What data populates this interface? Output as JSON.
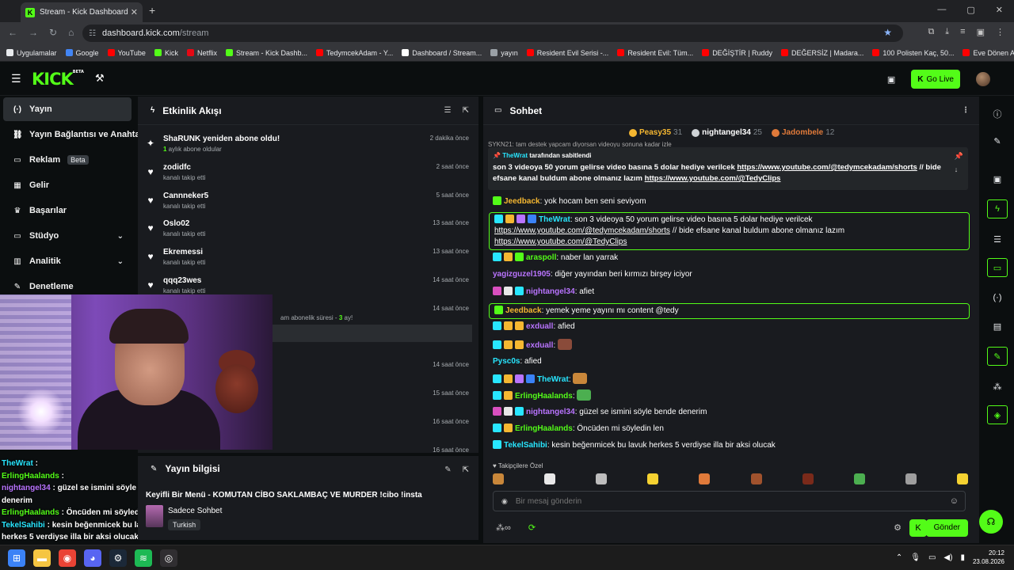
{
  "browser": {
    "tab_title": "Stream - Kick Dashboard",
    "tab_favicon": "K",
    "new_tab": "+",
    "url_host": "dashboard.kick.com",
    "url_path": "/stream",
    "bookmarks": [
      {
        "label": "Uygulamalar",
        "color": "#e8eaed"
      },
      {
        "label": "Google",
        "color": "#4285f4"
      },
      {
        "label": "YouTube",
        "color": "#ff0000"
      },
      {
        "label": "Kick",
        "color": "#53fc18"
      },
      {
        "label": "Netflix",
        "color": "#e50914"
      },
      {
        "label": "Stream - Kick Dashb...",
        "color": "#53fc18"
      },
      {
        "label": "TedymcekAdam - Y...",
        "color": "#ff0000"
      },
      {
        "label": "Dashboard / Stream...",
        "color": "#ffffff"
      },
      {
        "label": "yayın",
        "color": "#9aa0a6"
      },
      {
        "label": "Resident Evil Serisi -...",
        "color": "#ff0000"
      },
      {
        "label": "Resident Evil: Tüm...",
        "color": "#ff0000"
      },
      {
        "label": "DEĞİŞTİR | Ruddy",
        "color": "#ff0000"
      },
      {
        "label": "DEĞERSİZ | Madara...",
        "color": "#ff0000"
      },
      {
        "label": "100 Polisten Kaç, 50...",
        "color": "#ff0000"
      },
      {
        "label": "Eve Dönen Aile Bekl...",
        "color": "#ff0000"
      }
    ]
  },
  "kick": {
    "logo": "KICK",
    "logo_tag": "BETA",
    "go_live": "Go Live",
    "brand_color": "#53fc18"
  },
  "sidebar": {
    "items": [
      {
        "label": "Yayın",
        "icon": "broadcast-icon",
        "glyph": "(·)",
        "active": true
      },
      {
        "label": "Yayın Bağlantısı ve Anahtarı",
        "icon": "link-icon",
        "glyph": "⛓"
      },
      {
        "label": "Reklam",
        "icon": "ad-icon",
        "glyph": "▭",
        "badge": "Beta"
      },
      {
        "label": "Gelir",
        "icon": "revenue-icon",
        "glyph": "▦"
      },
      {
        "label": "Başarılar",
        "icon": "trophy-icon",
        "glyph": "♛"
      },
      {
        "label": "Stüdyo",
        "icon": "studio-icon",
        "glyph": "▭",
        "chevron": true
      },
      {
        "label": "Analitik",
        "icon": "analytics-icon",
        "glyph": "▥",
        "chevron": true
      },
      {
        "label": "Denetleme",
        "icon": "moderation-icon",
        "glyph": "✎"
      }
    ]
  },
  "events": {
    "title": "Etkinlik Akışı",
    "items": [
      {
        "icon": "sparkle-icon",
        "glyph": "✦",
        "name": "ShaRUNK yeniden abone oldu!",
        "sub_prefix": "1",
        "sub": " aylık abone oldular",
        "time": "2 dakika önce"
      },
      {
        "icon": "heart-icon",
        "glyph": "♥",
        "name": "zodidfc",
        "sub": "kanalı takip etti",
        "time": "2 saat önce"
      },
      {
        "icon": "heart-icon",
        "glyph": "♥",
        "name": "Cannneker5",
        "sub": "kanalı takip etti",
        "time": "5 saat önce"
      },
      {
        "icon": "heart-icon",
        "glyph": "♥",
        "name": "Oslo02",
        "sub": "kanalı takip etti",
        "time": "13 saat önce"
      },
      {
        "icon": "heart-icon",
        "glyph": "♥",
        "name": "Ekremessi",
        "sub": "kanalı takip etti",
        "time": "13 saat önce"
      },
      {
        "icon": "heart-icon",
        "glyph": "♥",
        "name": "qqq23wes",
        "sub": "kanalı takip etti",
        "time": "14 saat önce"
      },
      {
        "icon": "",
        "glyph": "",
        "name": "",
        "sub": "am abonelik süresi - ",
        "sub_suffix": "3",
        "sub_end": " ay!",
        "time": "14 saat önce"
      },
      {
        "icon": "",
        "glyph": "",
        "name": "",
        "sub": "",
        "time": ""
      },
      {
        "icon": "",
        "glyph": "",
        "name": "",
        "sub": "",
        "time": "14 saat önce"
      },
      {
        "icon": "",
        "glyph": "",
        "name": "",
        "sub": "",
        "time": "15 saat önce"
      },
      {
        "icon": "",
        "glyph": "",
        "name": "",
        "sub": "",
        "time": "16 saat önce"
      },
      {
        "icon": "",
        "glyph": "",
        "name": "",
        "sub": "",
        "time": "16 saat önce"
      }
    ]
  },
  "overlay_chat": [
    {
      "user": "TheWrat",
      "text": " : ",
      "color": "c"
    },
    {
      "user": "ErlingHaalands",
      "text": " : ",
      "color": "g"
    },
    {
      "user": "nightangel34",
      "text": " : güzel se ismini söyle bende denerim",
      "color": "p"
    },
    {
      "user": "ErlingHaalands",
      "text": " : Öncüden mi söyledin len",
      "color": "g"
    },
    {
      "user": "TekelSahibi",
      "text": " : kesin beğenmicek bu lavuk herkes 5 verdiyse illa bir aksi olucak",
      "color": "c"
    }
  ],
  "stream_info": {
    "title": "Yayın bilgisi",
    "stream_title": "Keyifli Bir Menü - KOMUTAN CİBO SAKLAMBAÇ VE MURDER !cibo !insta",
    "category": "Sadece Sohbet",
    "language": "Turkish"
  },
  "chat": {
    "title": "Sohbet",
    "leaderboard": [
      {
        "name": "Peasy35",
        "count": "31",
        "color": "#f5b731"
      },
      {
        "name": "nightangel34",
        "count": "25",
        "color": "#cfd3d6"
      },
      {
        "name": "Jadombele",
        "count": "12",
        "color": "#e07a3a"
      }
    ],
    "pinned_by_user": "TheWrat",
    "pinned_by_text": " tarafından sabitlendi",
    "pinned_text": "son 3 videoya 50 yorum gelirse video basına 5 dolar hediye verilcek ",
    "pinned_link1": "https://www.youtube.com/@tedymcekadam/shorts",
    "pinned_mid": " // bide efsane kanal buldum abone olmanız lazım ",
    "pinned_link2": "https://www.youtube.com/@TedyClips",
    "pinned_under": "SYKN21: tam destek yapcam diyorsan videoyu sonuna kadar izle",
    "messages": [
      {
        "user": "Jeedback",
        "ucolor": "#f5b731",
        "text": ": yok hocam ben seni seviyom",
        "badges": [
          "#53fc18"
        ],
        "hl": false
      },
      {
        "user": "TheWrat",
        "ucolor": "#28e6ff",
        "text": ": son 3 videoya 50 yorum gelirse video basına 5 dolar hediye verilcek ",
        "link1": "https://www.youtube.com/@tedymcekadam/shorts",
        "mid": " // bide efsane kanal buldum abone olmanız lazım ",
        "link2": "https://www.youtube.com/@TedyClips",
        "badges": [
          "#28e6ff",
          "#f5b731",
          "#b974ff",
          "#3b82f6"
        ],
        "hl": true
      },
      {
        "user": "araspoll",
        "ucolor": "#53fc18",
        "text": ": naber lan yarrak",
        "badges": [
          "#28e6ff",
          "#f5b731",
          "#53fc18"
        ],
        "hl": false
      },
      {
        "user": "yagizguzel1905",
        "ucolor": "#b974ff",
        "text": ": diğer yayından beri kırmızı birşey iciyor",
        "badges": [],
        "hl": false
      },
      {
        "user": "nightangel34",
        "ucolor": "#b974ff",
        "text": ": afiet",
        "badges": [
          "#d94fbf",
          "#e8e8e8",
          "#28e6ff"
        ],
        "hl": false
      },
      {
        "user": "Jeedback",
        "ucolor": "#f5b731",
        "text": ": yemek yeme yayını mı content @tedy",
        "badges": [
          "#53fc18"
        ],
        "hl": true
      },
      {
        "user": "exduall",
        "ucolor": "#b974ff",
        "text": ": afied",
        "badges": [
          "#28e6ff",
          "#f5b731",
          "#f5b731"
        ],
        "hl": false
      },
      {
        "user": "exduall",
        "ucolor": "#b974ff",
        "text": ": ",
        "badges": [
          "#28e6ff",
          "#f5b731",
          "#f5b731"
        ],
        "emote": "#8a4b3a",
        "hl": false
      },
      {
        "user": "Pysc0s",
        "ucolor": "#28e6ff",
        "text": ": afied",
        "badges": [],
        "hl": false
      },
      {
        "user": "TheWrat",
        "ucolor": "#28e6ff",
        "text": ": ",
        "badges": [
          "#28e6ff",
          "#f5b731",
          "#b974ff",
          "#3b82f6"
        ],
        "emote": "#c9873a",
        "hl": false
      },
      {
        "user": "ErlingHaalands",
        "ucolor": "#53fc18",
        "text": ": ",
        "badges": [
          "#28e6ff",
          "#f5b731"
        ],
        "emote": "#4caf50",
        "hl": false
      },
      {
        "user": "nightangel34",
        "ucolor": "#b974ff",
        "text": ": güzel se ismini söyle bende denerim",
        "badges": [
          "#d94fbf",
          "#e8e8e8",
          "#28e6ff"
        ],
        "hl": false
      },
      {
        "user": "ErlingHaalands",
        "ucolor": "#53fc18",
        "text": ": Öncüden mi söyledin len",
        "badges": [
          "#28e6ff",
          "#f5b731"
        ],
        "hl": false
      },
      {
        "user": "TekelSahibi",
        "ucolor": "#28e6ff",
        "text": ": kesin beğenmicek bu lavuk herkes 5 verdiyse illa bir aksi olucak",
        "badges": [
          "#28e6ff"
        ],
        "hl": false
      }
    ],
    "emotes_label": "Takipçilere Özel",
    "emote_colors": [
      "#c9873a",
      "#e8e8e8",
      "#bdbdbd",
      "#f5d231",
      "#e07a3a",
      "#a0522d",
      "#7a2a1a",
      "#4caf50",
      "#9e9e9e",
      "#f5d231"
    ],
    "input_placeholder": "Bir mesaj gönderin",
    "send_label": "Gönder"
  },
  "taskbar": {
    "time": "20:12",
    "date": "23.08.2026",
    "apps": [
      {
        "name": "windows-start-icon",
        "color": "#3b82f6",
        "glyph": "⊞"
      },
      {
        "name": "file-explorer-icon",
        "color": "#f5c542",
        "glyph": "▬"
      },
      {
        "name": "chrome-icon",
        "color": "#ea4335",
        "glyph": "◉"
      },
      {
        "name": "discord-icon",
        "color": "#5865f2",
        "glyph": "◕"
      },
      {
        "name": "steam-icon",
        "color": "#1b2838",
        "glyph": "⚙"
      },
      {
        "name": "spotify-icon",
        "color": "#1db954",
        "glyph": "≋"
      },
      {
        "name": "obs-icon",
        "color": "#302e31",
        "glyph": "◎"
      }
    ]
  }
}
